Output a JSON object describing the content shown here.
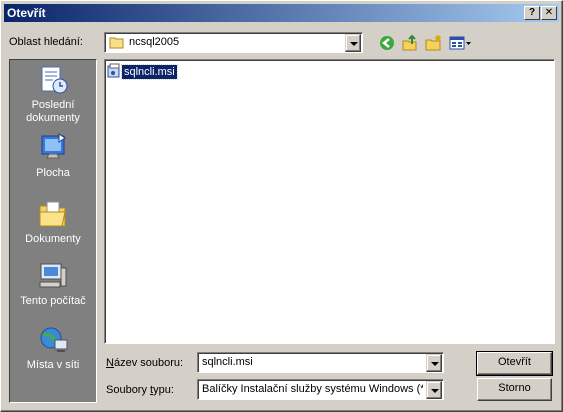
{
  "window": {
    "title": "Otevřít"
  },
  "titlebar_buttons": {
    "help": "?",
    "close": "✕"
  },
  "lookin": {
    "label": "Oblast hledání:",
    "value": "ncsql2005"
  },
  "toolbar": {
    "icons": [
      "back-icon",
      "up-folder-icon",
      "new-folder-icon",
      "view-menu-icon"
    ]
  },
  "places": [
    {
      "label_line1": "Poslední",
      "label_line2": "dokumenty",
      "icon": "recent-documents-icon"
    },
    {
      "label_line1": "Plocha",
      "label_line2": "",
      "icon": "desktop-icon"
    },
    {
      "label_line1": "Dokumenty",
      "label_line2": "",
      "icon": "documents-folder-icon"
    },
    {
      "label_line1": "Tento počítač",
      "label_line2": "",
      "icon": "my-computer-icon"
    },
    {
      "label_line1": "Místa v síti",
      "label_line2": "",
      "icon": "network-places-icon"
    }
  ],
  "files": [
    {
      "name": "sqlncli.msi",
      "icon": "msi-package-icon",
      "selected": true
    }
  ],
  "filename": {
    "label": "Název souboru:",
    "value": "sqlncli.msi"
  },
  "filetype": {
    "label": "Soubory typu:",
    "value": "Balíčky Instalační služby systému Windows (*.m"
  },
  "buttons": {
    "open": "Otevřít",
    "cancel": "Storno"
  }
}
